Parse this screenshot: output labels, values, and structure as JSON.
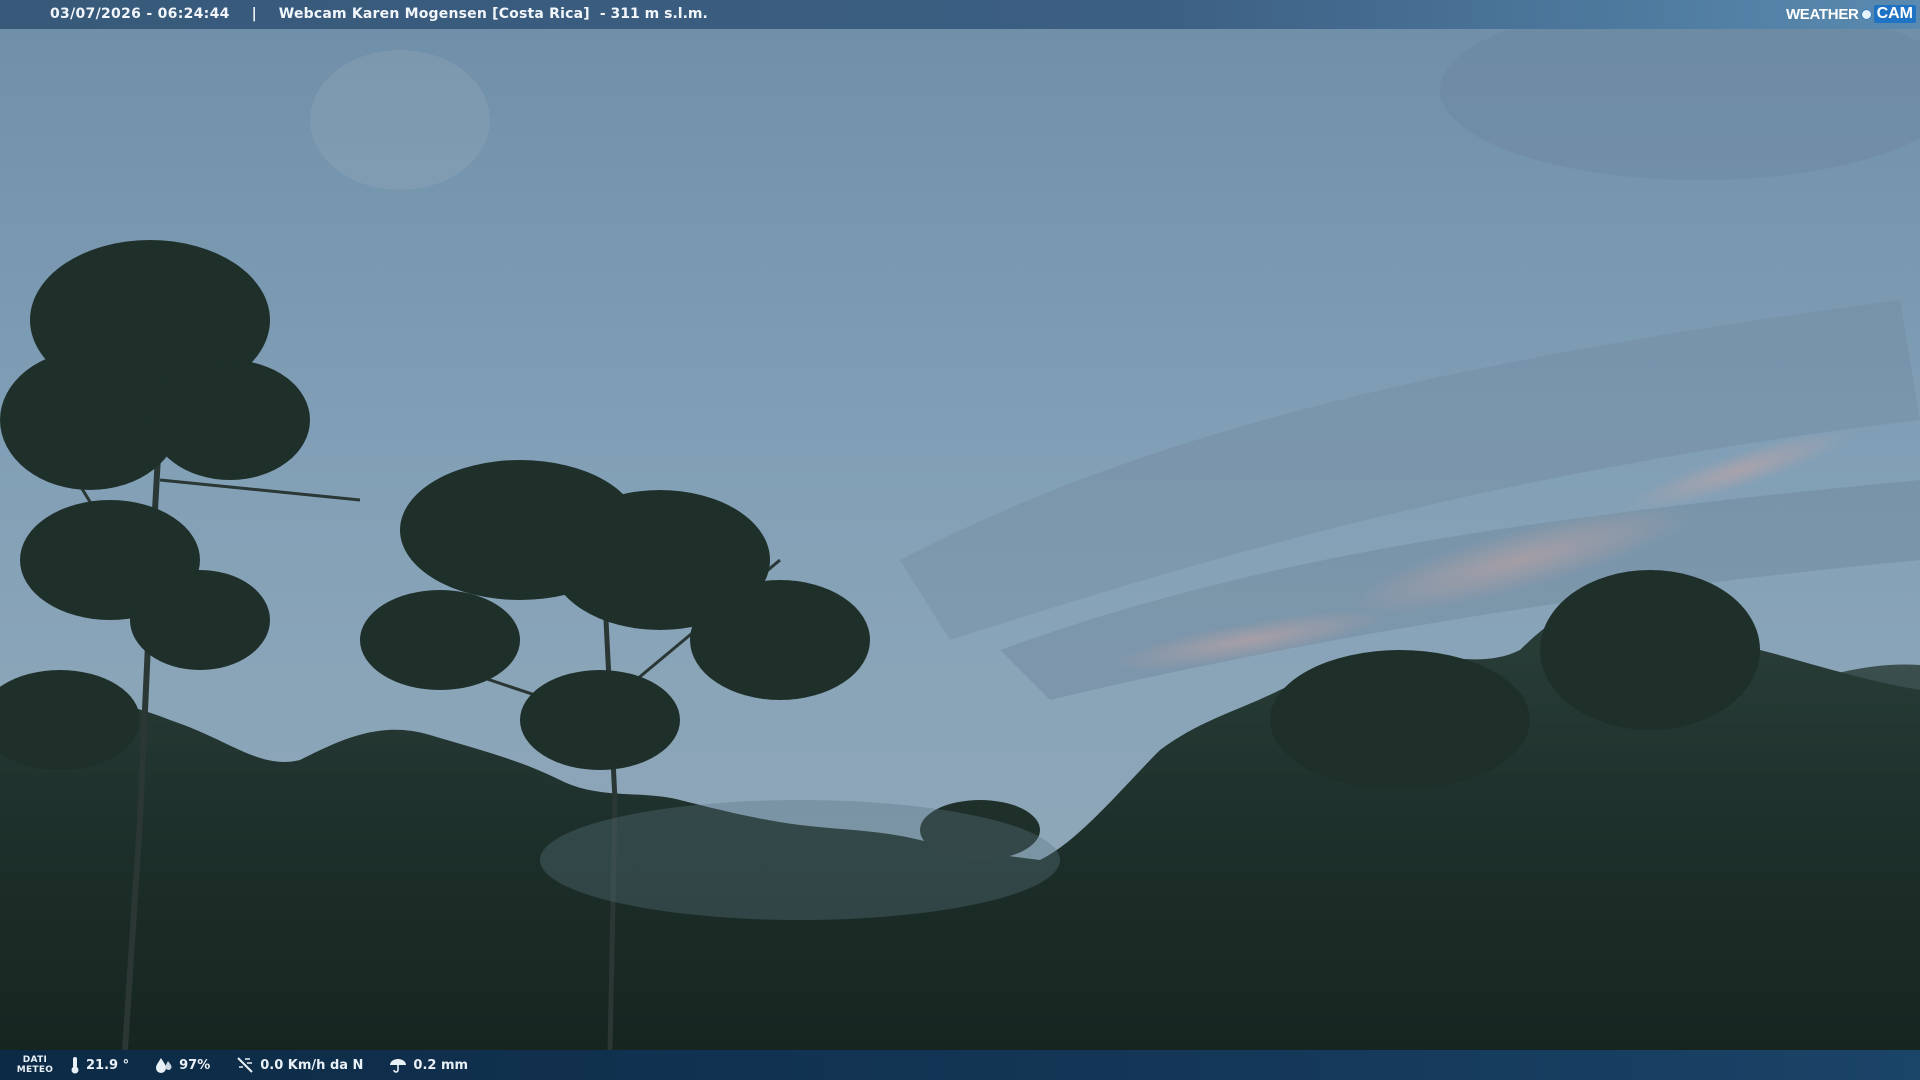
{
  "header": {
    "timestamp": "03/07/2026 - 06:24:44",
    "separator": "|",
    "title": "Webcam Karen Mogensen [Costa Rica]",
    "altitude": "- 311 m s.l.m."
  },
  "logo": {
    "weather": "WEATHER",
    "cam": "CAM"
  },
  "footer": {
    "label_line1": "DATI",
    "label_line2": "METEO",
    "temperature": "21.9 °",
    "humidity": "97%",
    "wind": "0.0 Km/h da N",
    "rain": "0.2 mm"
  },
  "icons": {
    "temperature": "thermometer-icon",
    "humidity": "humidity-icon",
    "wind": "wind-icon",
    "rain": "rain-icon"
  }
}
